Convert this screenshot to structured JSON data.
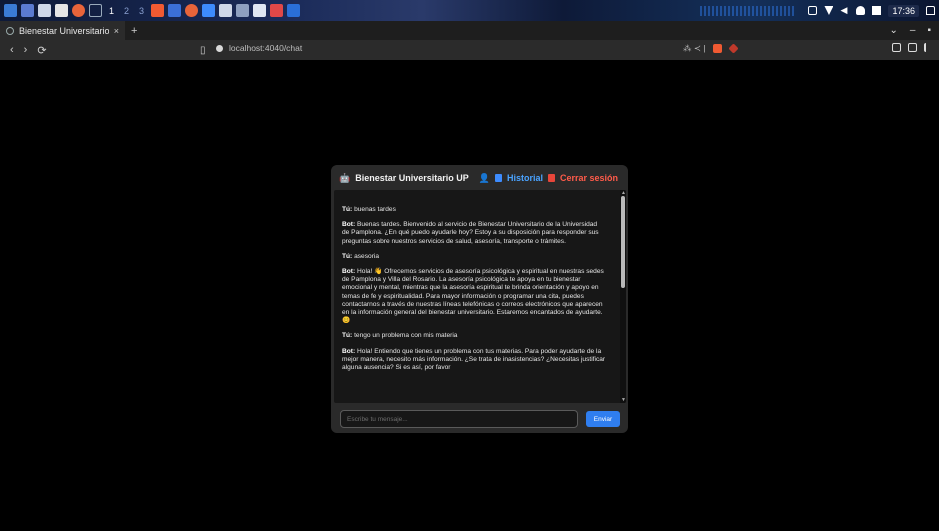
{
  "taskbar": {
    "workspaces": [
      "1",
      "2",
      "3"
    ],
    "clock": "17:36"
  },
  "browser": {
    "tab_title": "Bienestar Universitario",
    "tab_close": "×",
    "new_tab": "+",
    "url": "localhost:4040/chat",
    "window_controls": [
      "⌄",
      "–",
      "▪"
    ],
    "addr_right_text": "⁂  ≺ |"
  },
  "chat": {
    "header": {
      "bot_icon": "🤖",
      "title": "Bienestar Universitario UP",
      "user_icon": "👤",
      "history_label": "Historial",
      "logout_label": "Cerrar sesión"
    },
    "messages": [
      {
        "sender": "Tú:",
        "text": " buenas tardes"
      },
      {
        "sender": "Bot:",
        "text": " Buenas tardes. Bienvenido al servicio de Bienestar Universitario de la Universidad de Pamplona. ¿En qué puedo ayudarle hoy? Estoy a su disposición para responder sus preguntas sobre nuestros servicios de salud, asesoría, transporte o trámites."
      },
      {
        "sender": "Tú:",
        "text": " asesoria"
      },
      {
        "sender": "Bot:",
        "text": " Hola! 👋 Ofrecemos servicios de asesoría psicológica y espiritual en nuestras sedes de Pamplona y Villa del Rosario. La asesoría psicológica te apoya en tu bienestar emocional y mental, mientras que la asesoría espiritual te brinda orientación y apoyo en temas de fe y espiritualidad. Para mayor información o programar una cita, puedes contactarnos a través de nuestras líneas telefónicas o correos electrónicos que aparecen en la información general del bienestar universitario. Estaremos encantados de ayudarte. 😊"
      },
      {
        "sender": "Tú:",
        "text": " tengo un problema con mis materia"
      },
      {
        "sender": "Bot:",
        "text": " Hola! Entiendo que tienes un problema con tus materias. Para poder ayudarte de la mejor manera, necesito más información. ¿Se trata de inasistencias? ¿Necesitas justificar alguna ausencia? Si es así, por favor"
      }
    ],
    "input_placeholder": "Escribe tu mensaje...",
    "send_label": "Enviar"
  },
  "colors": {
    "accent_blue": "#2f7ef0",
    "history_blue": "#4aa3ff",
    "logout_red": "#ff5b4a",
    "background": "#000000",
    "card": "#2a2a2a"
  }
}
